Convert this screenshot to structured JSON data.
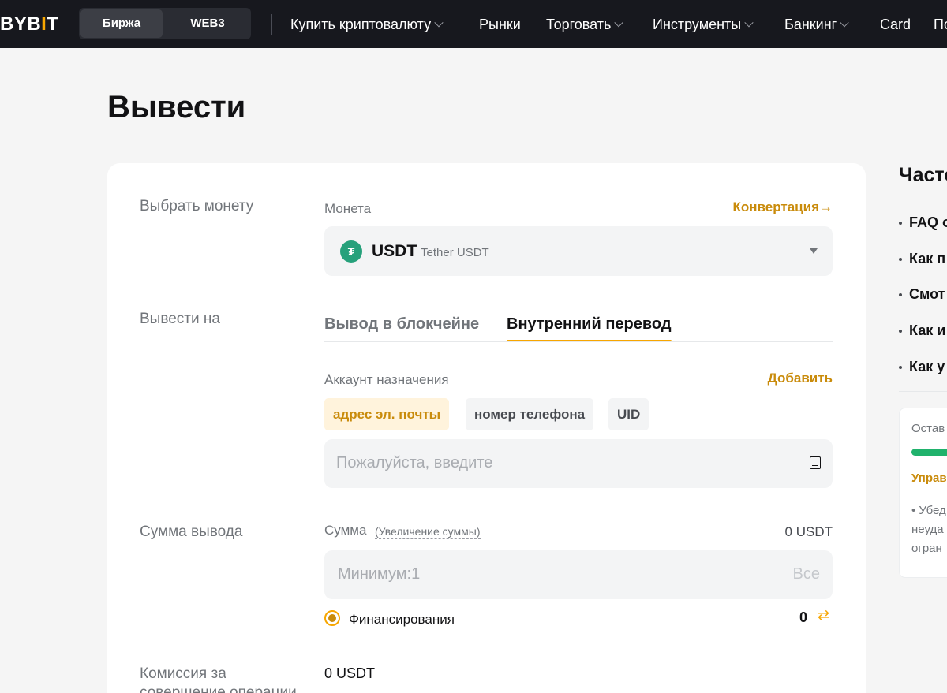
{
  "nav": {
    "logo_main": "BYB",
    "logo_bar": "I",
    "logo_end": "T",
    "segments": [
      "Биржа",
      "WEB3"
    ],
    "items": [
      "Купить криптовалюту",
      "Рынки",
      "Торговать",
      "Инструменты",
      "Банкинг",
      "Card",
      "По"
    ]
  },
  "page": {
    "title": "Вывести"
  },
  "withdraw": {
    "coin_row_label": "Выбрать монету",
    "coin_label": "Монета",
    "convert_link": "Конвертация→",
    "coin_symbol": "USDT",
    "coin_name": "Tether USDT",
    "coin_icon": "tether-icon",
    "to_row_label": "Вывести на",
    "tabs": [
      "Вывод в блокчейне",
      "Внутренний перевод"
    ],
    "active_tab": 1,
    "dest_label": "Аккаунт назначения",
    "add_link": "Добавить",
    "chips": [
      "адрес эл. почты",
      "номер телефона",
      "UID"
    ],
    "active_chip": 0,
    "dest_placeholder": "Пожалуйста, введите",
    "amount_row_label": "Сумма вывода",
    "amount_label": "Сумма",
    "amount_hint": "(Увеличение суммы)",
    "amount_balance": "0 USDT",
    "amount_placeholder": "Минимум:1",
    "all_button": "Все",
    "funding_label": "Финансирования",
    "funding_value": "0",
    "fee_row_label_1": "Комиссия за",
    "fee_row_label_2": "совершение операции",
    "fee_value": "0 USDT"
  },
  "faq": {
    "title": "Часто",
    "items": [
      "FAQ о",
      "Как п",
      "Смот",
      "Как и",
      "Как у"
    ]
  },
  "side_card": {
    "line1": "Остав",
    "link": "Управ",
    "text1": "• Убед",
    "text2": "неуда",
    "text3": "огран"
  },
  "colors": {
    "accent": "#f7a600",
    "accent_text": "#c98b0b",
    "success": "#20b26c",
    "nav_bg": "#17181e"
  }
}
